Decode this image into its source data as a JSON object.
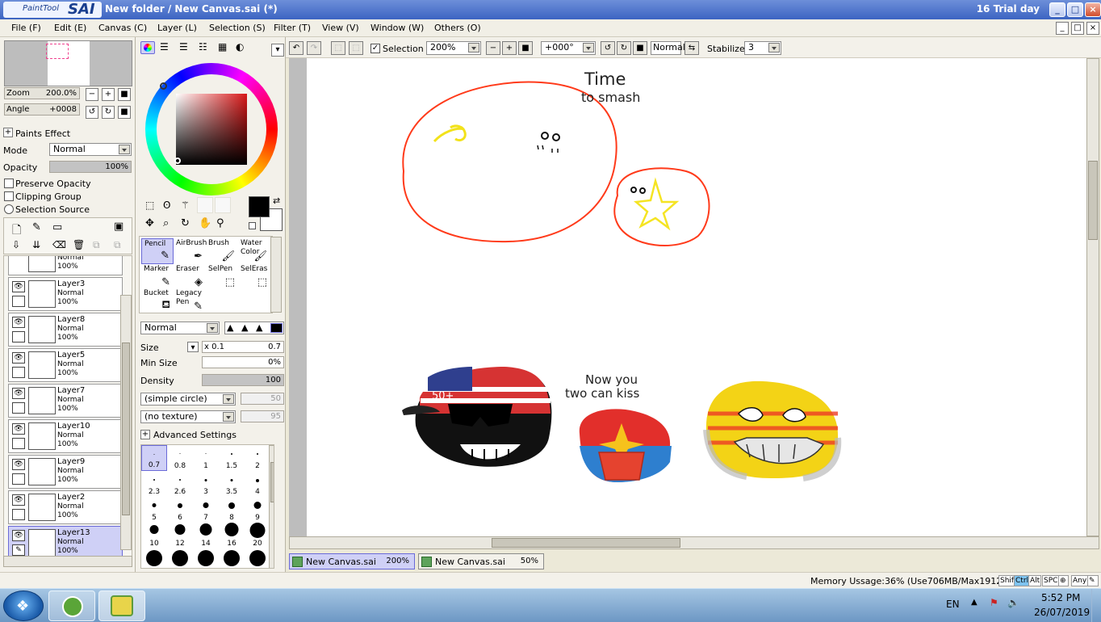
{
  "window": {
    "app_logo": "PaintTool SAI",
    "logo_small": "PaintTool",
    "logo_big": "SAI",
    "title": "New folder / New Canvas.sai (*)",
    "trial": "16 Trial day"
  },
  "menu": [
    "File (F)",
    "Edit (E)",
    "Canvas (C)",
    "Layer (L)",
    "Selection (S)",
    "Filter (T)",
    "View (V)",
    "Window (W)",
    "Others (O)"
  ],
  "navigator": {
    "zoom_label": "Zoom",
    "zoom_value": "200.0%",
    "angle_label": "Angle",
    "angle_value": "+0008"
  },
  "paints_effect": {
    "header": "Paints Effect",
    "mode_label": "Mode",
    "mode_value": "Normal",
    "opacity_label": "Opacity",
    "opacity_value": "100%"
  },
  "checkboxes": {
    "preserve_opacity": "Preserve Opacity",
    "clipping_group": "Clipping Group",
    "selection_source": "Selection Source"
  },
  "layers": [
    {
      "name": "",
      "mode": "Normal",
      "opacity": "100%",
      "selected": false
    },
    {
      "name": "Layer3",
      "mode": "Normal",
      "opacity": "100%",
      "selected": false
    },
    {
      "name": "Layer8",
      "mode": "Normal",
      "opacity": "100%",
      "selected": false
    },
    {
      "name": "Layer5",
      "mode": "Normal",
      "opacity": "100%",
      "selected": false
    },
    {
      "name": "Layer7",
      "mode": "Normal",
      "opacity": "100%",
      "selected": false
    },
    {
      "name": "Layer10",
      "mode": "Normal",
      "opacity": "100%",
      "selected": false
    },
    {
      "name": "Layer9",
      "mode": "Normal",
      "opacity": "100%",
      "selected": false
    },
    {
      "name": "Layer2",
      "mode": "Normal",
      "opacity": "100%",
      "selected": false
    },
    {
      "name": "Layer13",
      "mode": "Normal",
      "opacity": "100%",
      "selected": true
    }
  ],
  "tools": [
    {
      "label": "Pencil",
      "icon": "pencil-icon",
      "selected": true
    },
    {
      "label": "AirBrush",
      "icon": "airbrush-icon",
      "selected": false
    },
    {
      "label": "Brush",
      "icon": "brush-icon",
      "selected": false
    },
    {
      "label": "Water Color",
      "icon": "watercolor-icon",
      "selected": false
    },
    {
      "label": "Marker",
      "icon": "marker-icon",
      "selected": false
    },
    {
      "label": "Eraser",
      "icon": "eraser-icon",
      "selected": false
    },
    {
      "label": "SelPen",
      "icon": "selpen-icon",
      "selected": false
    },
    {
      "label": "SelEras",
      "icon": "seleras-icon",
      "selected": false
    },
    {
      "label": "Bucket",
      "icon": "bucket-icon",
      "selected": false
    },
    {
      "label": "Legacy Pen",
      "icon": "legacypen-icon",
      "selected": false
    }
  ],
  "brush_settings": {
    "blend_mode": "Normal",
    "size_label": "Size",
    "size_multiplier": "x 0.1",
    "size_value": "0.7",
    "min_size_label": "Min Size",
    "min_size_value": "0%",
    "density_label": "Density",
    "density_value": "100",
    "shape": "(simple circle)",
    "shape_value": "50",
    "texture": "(no texture)",
    "texture_value": "95",
    "advanced": "Advanced Settings"
  },
  "brush_sizes": [
    "0.7",
    "0.8",
    "1",
    "1.5",
    "2",
    "2.3",
    "2.6",
    "3",
    "3.5",
    "4",
    "5",
    "6",
    "7",
    "8",
    "9",
    "10",
    "12",
    "14",
    "16",
    "20"
  ],
  "canvas_toolbar": {
    "selection_label": "Selection",
    "zoom": "200%",
    "rotation": "+000°",
    "blend": "Normal",
    "stabilizer_label": "Stabilizer",
    "stabilizer_value": "3"
  },
  "canvas_text": {
    "time": "Time",
    "to_smash": "to smash",
    "now_you": "Now you",
    "two_can_kiss": "two can kiss",
    "cap_text": "50+"
  },
  "tabs": [
    {
      "name": "New Canvas.sai",
      "zoom": "200%",
      "selected": true
    },
    {
      "name": "New Canvas.sai",
      "zoom": "50%",
      "selected": false
    }
  ],
  "status": {
    "memory": "Memory Ussage:36% (Use706MB/Max1912MB)",
    "keys": [
      "Shift",
      "Ctrl",
      "Alt",
      "SPC",
      "Any"
    ]
  },
  "taskbar": {
    "lang": "EN",
    "time": "5:52 PM",
    "date": "26/07/2019"
  },
  "colors": {
    "accent": "#6a6ad8",
    "title_bar": "#3c64c2",
    "selected_row": "#cfd0f6"
  }
}
